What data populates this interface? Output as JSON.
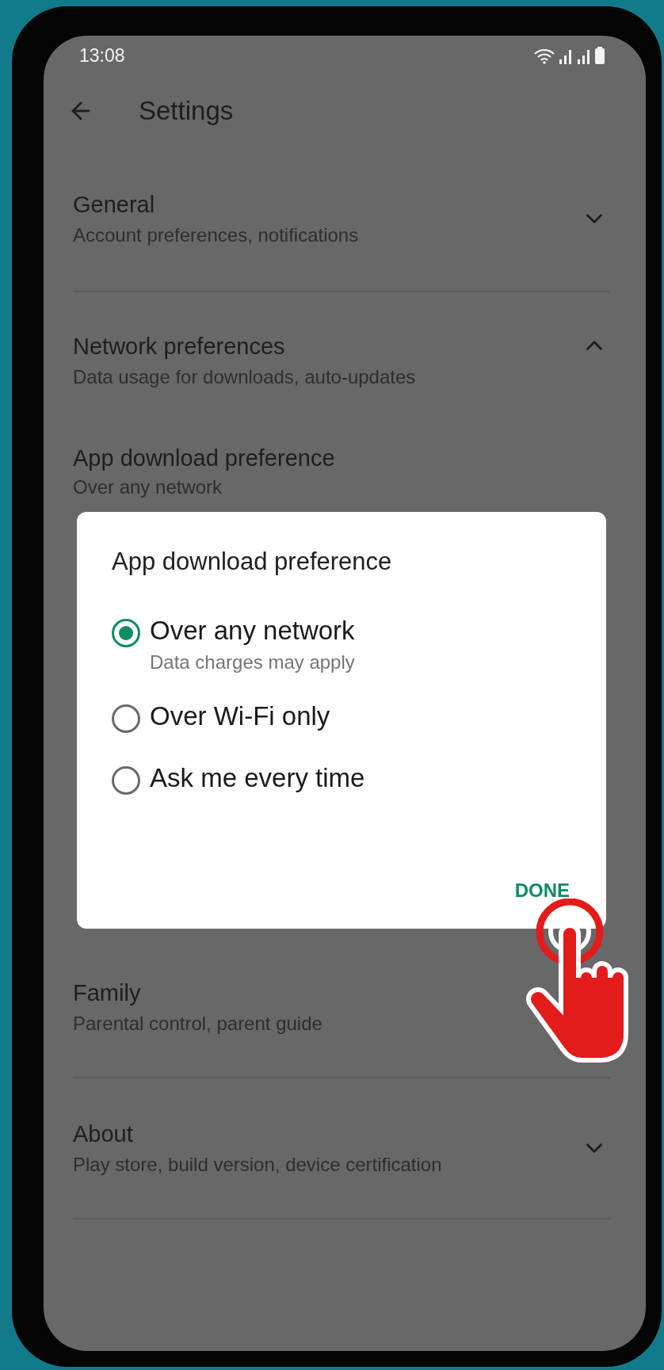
{
  "status_bar": {
    "time": "13:08"
  },
  "header": {
    "title": "Settings"
  },
  "sections": [
    {
      "title": "General",
      "subtitle": "Account preferences, notifications",
      "expanded": false
    },
    {
      "title": "Network preferences",
      "subtitle": "Data usage for downloads, auto-updates",
      "expanded": true,
      "children": [
        {
          "title": "App download preference",
          "subtitle": "Over any network"
        }
      ]
    },
    {
      "title": "Family",
      "subtitle": "Parental control, parent guide"
    },
    {
      "title": "About",
      "subtitle": "Play store, build version, device certification",
      "expanded": false
    }
  ],
  "dialog": {
    "title": "App download preference",
    "options": [
      {
        "label": "Over any network",
        "subtitle": "Data charges may apply",
        "selected": true
      },
      {
        "label": "Over Wi-Fi only",
        "selected": false
      },
      {
        "label": "Ask me every time",
        "selected": false
      }
    ],
    "button": "DONE"
  }
}
